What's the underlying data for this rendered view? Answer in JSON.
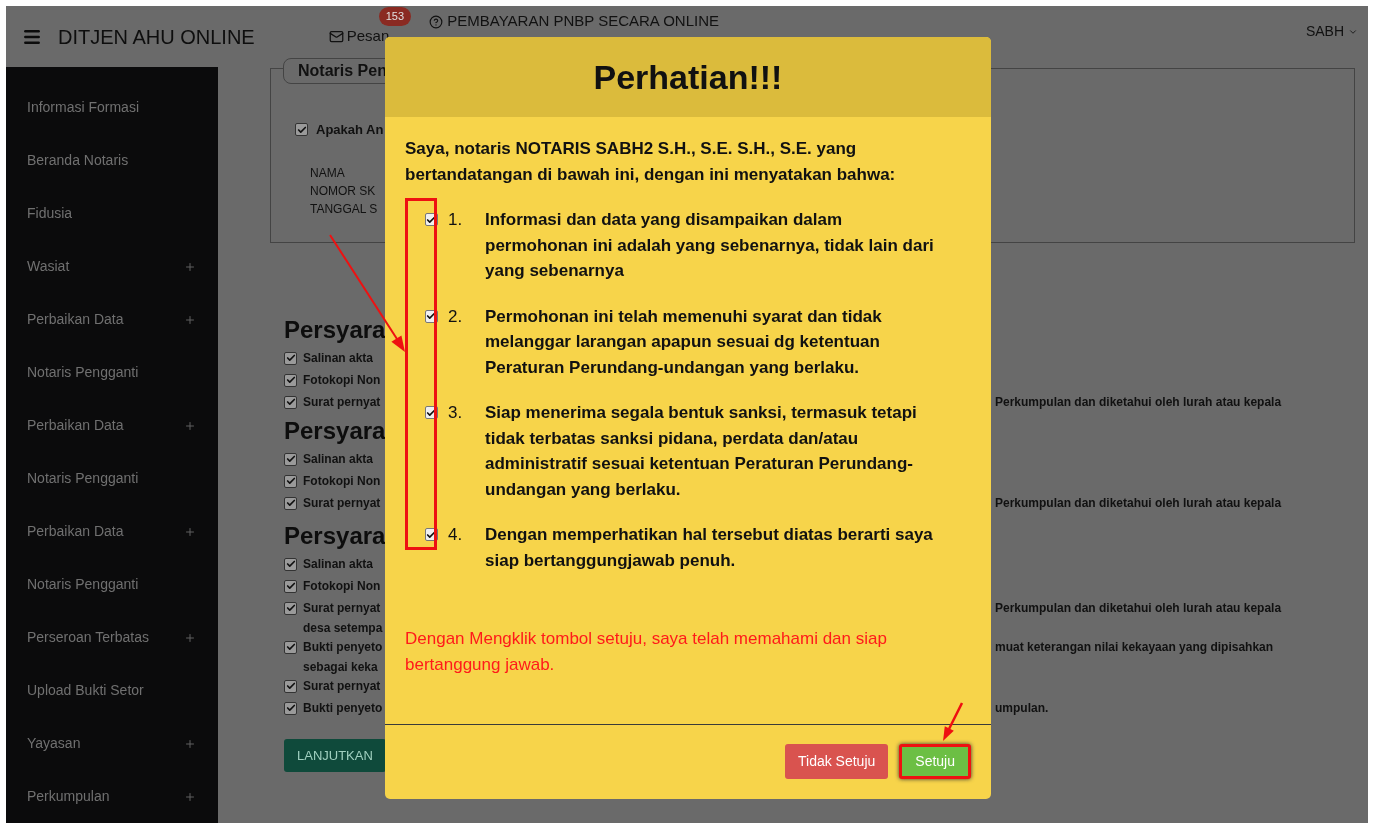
{
  "topbar": {
    "brand": "DITJEN AHU ONLINE",
    "messages_label": "Pesan",
    "messages_badge": "153",
    "payment_link": "PEMBAYARAN PNBP SECARA ONLINE",
    "user": "SABH"
  },
  "sidebar": {
    "items": [
      {
        "label": "Informasi Formasi",
        "expandable": false
      },
      {
        "label": "Beranda Notaris",
        "expandable": false
      },
      {
        "label": "Fidusia",
        "expandable": false
      },
      {
        "label": "Wasiat",
        "expandable": true
      },
      {
        "label": "Perbaikan Data",
        "expandable": true
      },
      {
        "label": "Notaris Pengganti",
        "expandable": false
      },
      {
        "label": "Perbaikan Data",
        "expandable": true
      },
      {
        "label": "Notaris Pengganti",
        "expandable": false
      },
      {
        "label": "Perbaikan Data",
        "expandable": true
      },
      {
        "label": "Notaris Pengganti",
        "expandable": false
      },
      {
        "label": "Perseroan Terbatas",
        "expandable": true
      },
      {
        "label": "Upload Bukti Setor",
        "expandable": false
      },
      {
        "label": "Yayasan",
        "expandable": true
      },
      {
        "label": "Perkumpulan",
        "expandable": true
      }
    ]
  },
  "main": {
    "card": {
      "legend": "Notaris Pen",
      "checkbox": {
        "label": "Apakah An",
        "checked": true
      },
      "fields": [
        "NAMA",
        "NOMOR SK",
        "TANGGAL S"
      ]
    },
    "sections": [
      {
        "heading": "Persyara",
        "items": [
          {
            "lines": [
              "Salinan akta"
            ],
            "checked": true
          },
          {
            "lines": [
              "Fotokopi Non"
            ],
            "checked": true
          },
          {
            "lines": [
              "Surat pernyat"
            ],
            "checked": true,
            "right": "Perkumpulan dan diketahui oleh lurah atau kepala"
          }
        ]
      },
      {
        "heading": "Persyara",
        "items": [
          {
            "lines": [
              "Salinan akta"
            ],
            "checked": true
          },
          {
            "lines": [
              "Fotokopi Non"
            ],
            "checked": true
          },
          {
            "lines": [
              "Surat pernyat"
            ],
            "checked": true,
            "right": "Perkumpulan dan diketahui oleh lurah atau kepala"
          }
        ]
      },
      {
        "heading": "Persyara",
        "items": [
          {
            "lines": [
              "Salinan akta"
            ],
            "checked": true
          },
          {
            "lines": [
              "Fotokopi Non"
            ],
            "checked": true
          },
          {
            "lines": [
              "Surat pernyat",
              "desa setempa"
            ],
            "checked": true,
            "right": "Perkumpulan dan diketahui oleh lurah atau kepala"
          },
          {
            "lines": [
              "Bukti penyeto",
              "sebagai keka"
            ],
            "checked": true,
            "right": "muat keterangan nilai kekayaan yang dipisahkan"
          },
          {
            "lines": [
              "Surat pernyat"
            ],
            "checked": true
          },
          {
            "lines": [
              "Bukti penyeto"
            ],
            "checked": true,
            "right": "umpulan."
          }
        ]
      }
    ],
    "continue_button": "LANJUTKAN"
  },
  "modal": {
    "title": "Perhatian!!!",
    "intro": "Saya, notaris NOTARIS SABH2 S.H., S.E. S.H., S.E. yang bertandatangan di bawah ini, dengan ini menyatakan bahwa:",
    "checkboxes_highlighted": true,
    "statements": [
      {
        "number": "1.",
        "text": "Informasi dan data yang disampaikan dalam permohonan ini adalah yang sebenarnya, tidak lain dari yang sebenarnya",
        "checked": true
      },
      {
        "number": "2.",
        "text": "Permohonan ini telah memenuhi syarat dan tidak melanggar larangan apapun sesuai dg ketentuan Peraturan Perundang-undangan yang berlaku.",
        "checked": true
      },
      {
        "number": "3.",
        "text": "Siap menerima segala bentuk sanksi, termasuk tetapi tidak terbatas sanksi pidana, perdata dan/atau administratif sesuai ketentuan Peraturan Perundang-undangan yang berlaku.",
        "checked": true
      },
      {
        "number": "4.",
        "text": "Dengan memperhatikan hal tersebut diatas berarti saya siap bertanggungjawab penuh.",
        "checked": true
      }
    ],
    "warning": "Dengan Mengklik tombol setuju, saya telah memahami dan siap bertanggung jawab.",
    "buttons": [
      {
        "label": "Tidak Setuju",
        "kind": "danger",
        "highlighted": false
      },
      {
        "label": "Setuju",
        "kind": "success",
        "highlighted": true
      }
    ]
  }
}
